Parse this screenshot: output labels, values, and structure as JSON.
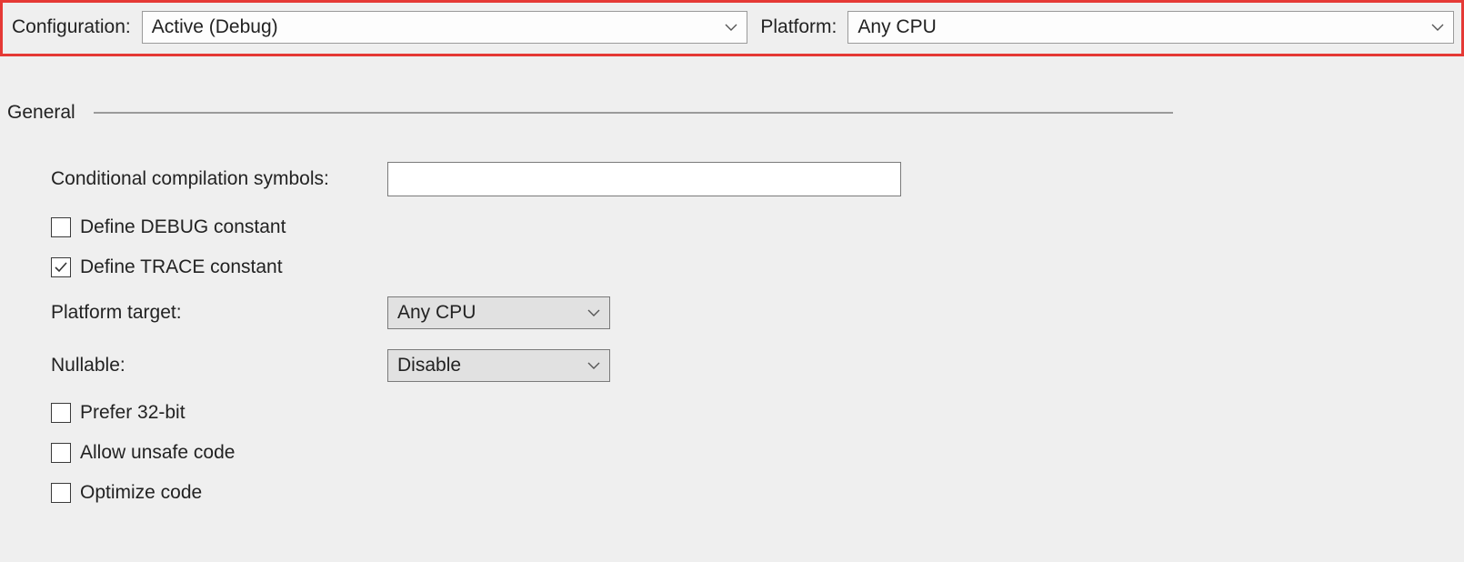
{
  "topbar": {
    "configuration_label": "Configuration:",
    "configuration_value": "Active (Debug)",
    "platform_label": "Platform:",
    "platform_value": "Any CPU"
  },
  "section": {
    "general_title": "General"
  },
  "fields": {
    "symbols_label": "Conditional compilation symbols:",
    "symbols_value": "",
    "define_debug_label": "Define DEBUG constant",
    "define_trace_label": "Define TRACE constant",
    "platform_target_label": "Platform target:",
    "platform_target_value": "Any CPU",
    "nullable_label": "Nullable:",
    "nullable_value": "Disable",
    "prefer_32bit_label": "Prefer 32-bit",
    "allow_unsafe_label": "Allow unsafe code",
    "optimize_code_label": "Optimize code"
  }
}
